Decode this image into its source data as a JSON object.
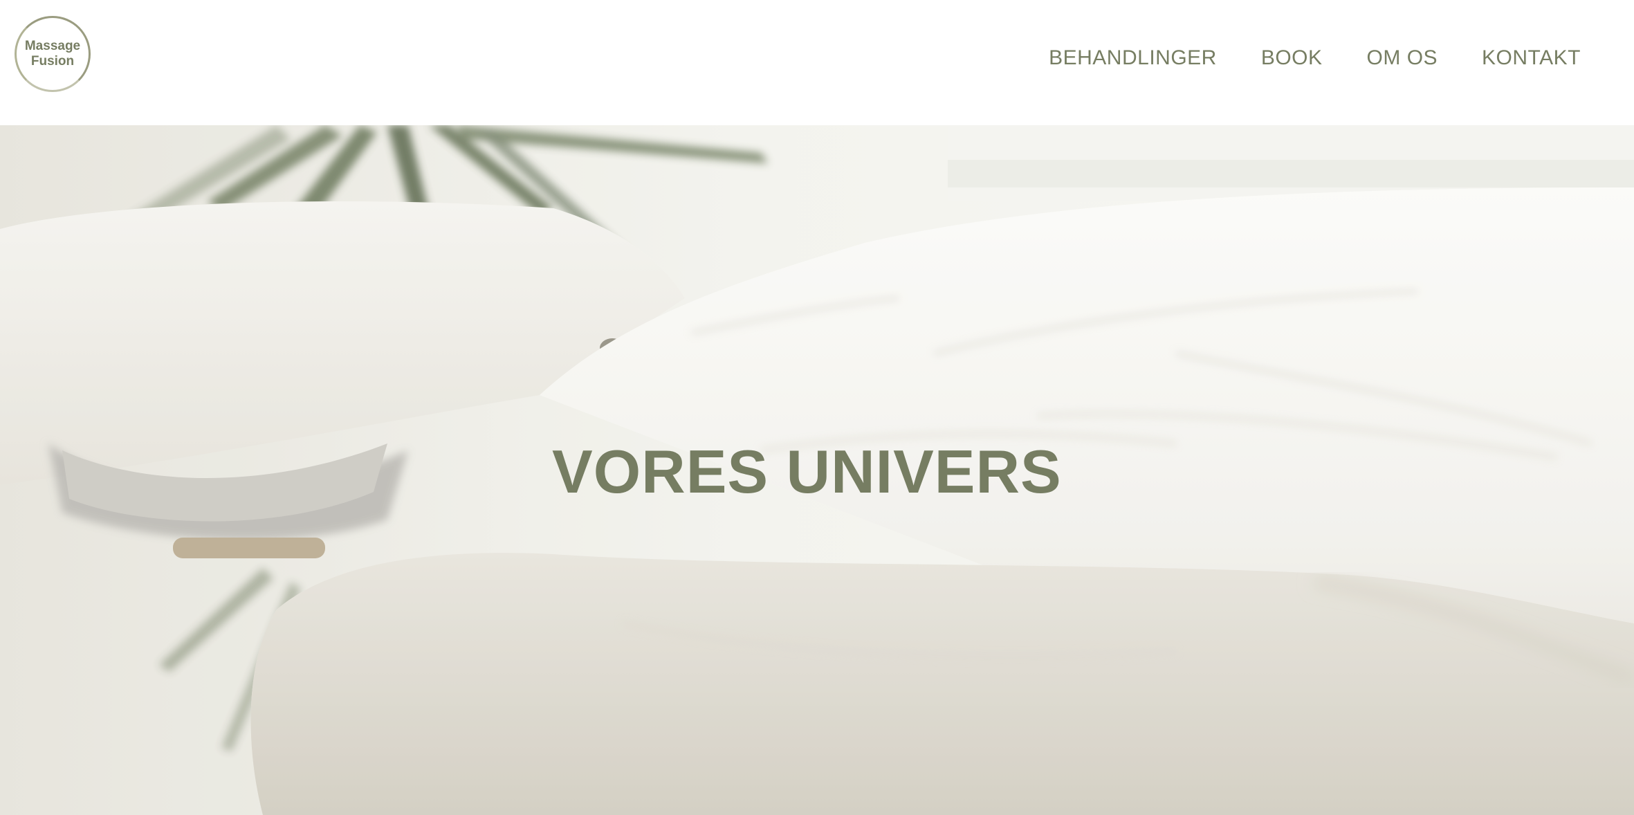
{
  "logo": {
    "line1": "Massage",
    "line2": "Fusion"
  },
  "nav": {
    "items": [
      {
        "label": "BEHANDLINGER"
      },
      {
        "label": "BOOK"
      },
      {
        "label": "OM OS"
      },
      {
        "label": "KONTAKT"
      }
    ]
  },
  "hero": {
    "title": "VORES UNIVERS",
    "image": "massage-table-with-white-sheet-and-plant"
  },
  "colors": {
    "brand": "#767d62",
    "header_bg": "#ffffff"
  }
}
